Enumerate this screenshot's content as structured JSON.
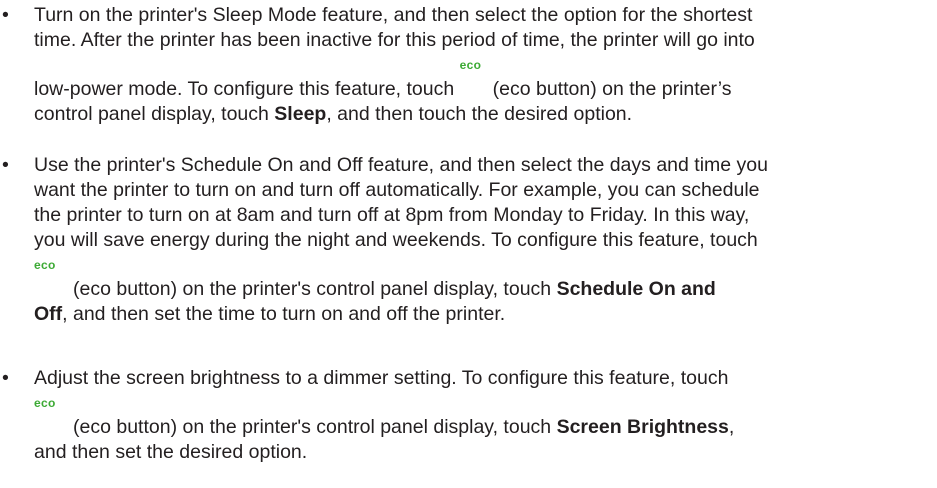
{
  "bullet_symbol": "•",
  "eco_label": "eco",
  "b1": {
    "l1": "Turn on the printer's Sleep Mode feature, and then select the option for the shortest",
    "l2": "time. After the printer has been inactive for this period of time, the printer will go into",
    "l3a": "low-power mode. To configure this feature, touch ",
    "l3b": " (eco button) on the printer’s",
    "l4a": "control panel display, touch ",
    "l4bold": "Sleep",
    "l4b": ", and then touch the desired option."
  },
  "b2": {
    "l1": "Use the printer's Schedule On and Off feature, and then select the days and time you",
    "l2": "want the printer to turn on and turn off automatically. For example, you can schedule",
    "l3": "the printer to turn on at 8am and turn off at 8pm from Monday to Friday. In this way,",
    "l4": "you will save energy during the night and weekends. To configure this feature, touch",
    "l5a": " (eco button) on the printer's control panel display, touch ",
    "l5bold": "Schedule On and",
    "l6bold": "Off",
    "l6b": ", and then set the time to turn on and off the printer."
  },
  "b3": {
    "l1": "Adjust the screen brightness to a dimmer setting. To configure this feature, touch",
    "l2a": " (eco button) on the printer's control panel display, touch ",
    "l2bold": "Screen Brightness",
    "l2b": ",",
    "l3": "and then set the desired option."
  },
  "colors": {
    "text": "#231f20",
    "eco": "#3daa35"
  }
}
